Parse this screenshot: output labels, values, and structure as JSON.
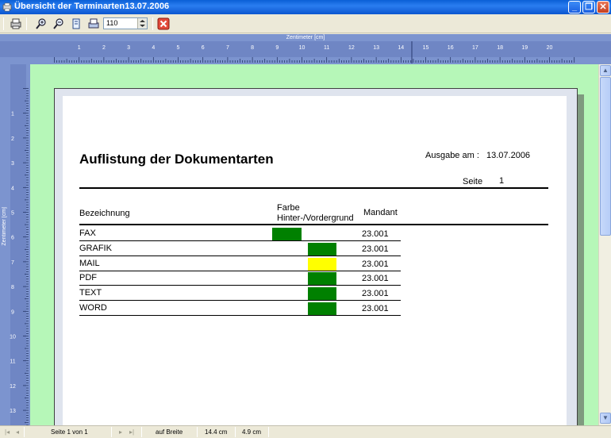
{
  "window": {
    "title": "Übersicht der Terminarten13.07.2006",
    "minimize_icon": "minimize-icon",
    "maximize_icon": "restore-icon",
    "close_icon": "close-icon"
  },
  "toolbar": {
    "zoom_value": "110",
    "icons": [
      "print-icon",
      "zoom-in-icon",
      "zoom-out-icon",
      "fit-page-icon",
      "print-setup-icon",
      "close-preview-icon"
    ]
  },
  "ruler": {
    "top_title": "Zentimeter [cm]",
    "left_title": "Zentimeter [cm]",
    "top_numbers": [
      "1",
      "2",
      "3",
      "4",
      "5",
      "6",
      "7",
      "8",
      "9",
      "10",
      "11",
      "12",
      "13",
      "14",
      "15",
      "16",
      "17",
      "18",
      "19",
      "20"
    ],
    "left_numbers": [
      "1",
      "2",
      "3",
      "4",
      "5",
      "6",
      "7",
      "8",
      "9",
      "10",
      "11",
      "12",
      "13"
    ]
  },
  "report": {
    "title": "Auflistung der Dokumentarten",
    "issue_label": "Ausgabe am :",
    "issue_date": "13.07.2006",
    "page_label": "Seite",
    "page_number": "1",
    "columns": {
      "name": "Bezeichnung",
      "color_line1": "Farbe",
      "color_line2": "Hinter-/Vordergrund",
      "mandant": "Mandant"
    },
    "rows": [
      {
        "name": "FAX",
        "mandant": "23.001",
        "color": "#008000"
      },
      {
        "name": "GRAFIK",
        "mandant": "23.001",
        "color": "#008000"
      },
      {
        "name": "MAIL",
        "mandant": "23.001",
        "color": "#ffff00"
      },
      {
        "name": "PDF",
        "mandant": "23.001",
        "color": "#008000"
      },
      {
        "name": "TEXT",
        "mandant": "23.001",
        "color": "#008000"
      },
      {
        "name": "WORD",
        "mandant": "23.001",
        "color": "#008000"
      }
    ]
  },
  "status": {
    "page_info": "Seite 1 von 1",
    "zoom_mode": "auf Breite",
    "x_pos": "14.4 cm",
    "y_pos": "4.9 cm"
  },
  "colors": {
    "title_bar": "#0a5fd6",
    "ruler": "#7c94cf",
    "viewport_background": "#b6f7b8"
  }
}
